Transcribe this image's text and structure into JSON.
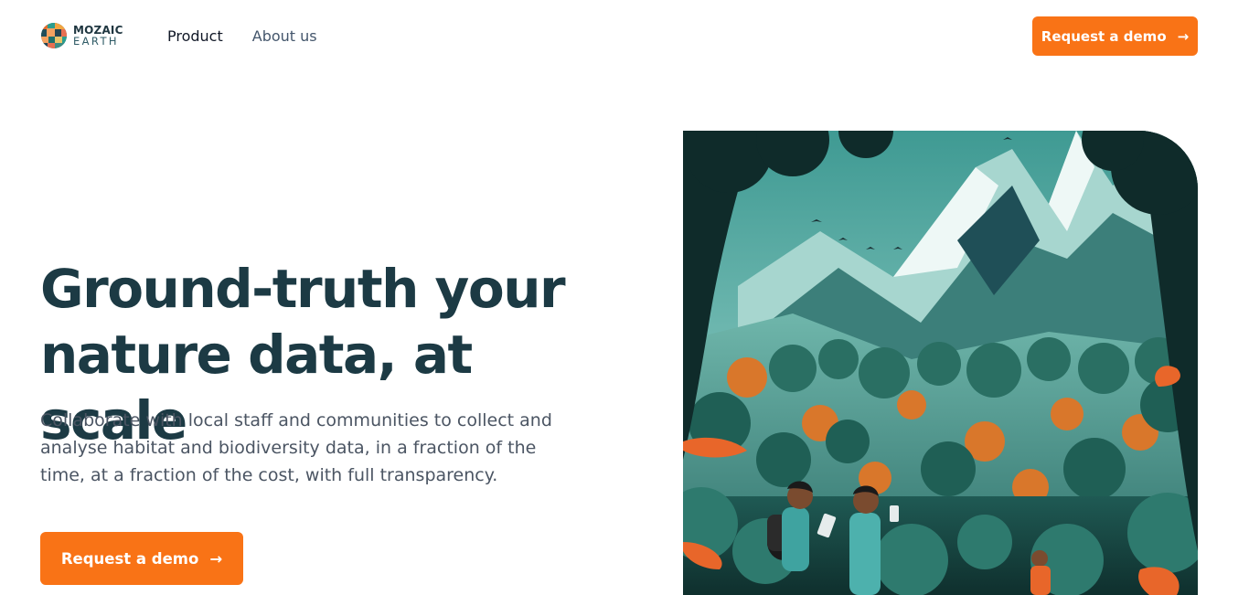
{
  "brand": {
    "name_top": "MOZAIC",
    "name_bottom": "EARTH"
  },
  "nav": {
    "items": [
      {
        "label": "Product"
      },
      {
        "label": "About us"
      }
    ]
  },
  "header": {
    "cta_label": "Request a demo",
    "cta_icon": "arrow-right-icon"
  },
  "hero": {
    "headline": "Ground-truth your nature data, at scale",
    "subtext": "Collaborate with local staff and communities to collect and analyse habitat and biodiversity data, in a fraction of the time, at a fraction of the cost, with full transparency.",
    "cta_label": "Request a demo",
    "cta_icon": "arrow-right-icon"
  },
  "colors": {
    "accent": "#f97316",
    "heading": "#1c3a44",
    "body_text": "#4b5563",
    "nav_text": "#44566c"
  }
}
